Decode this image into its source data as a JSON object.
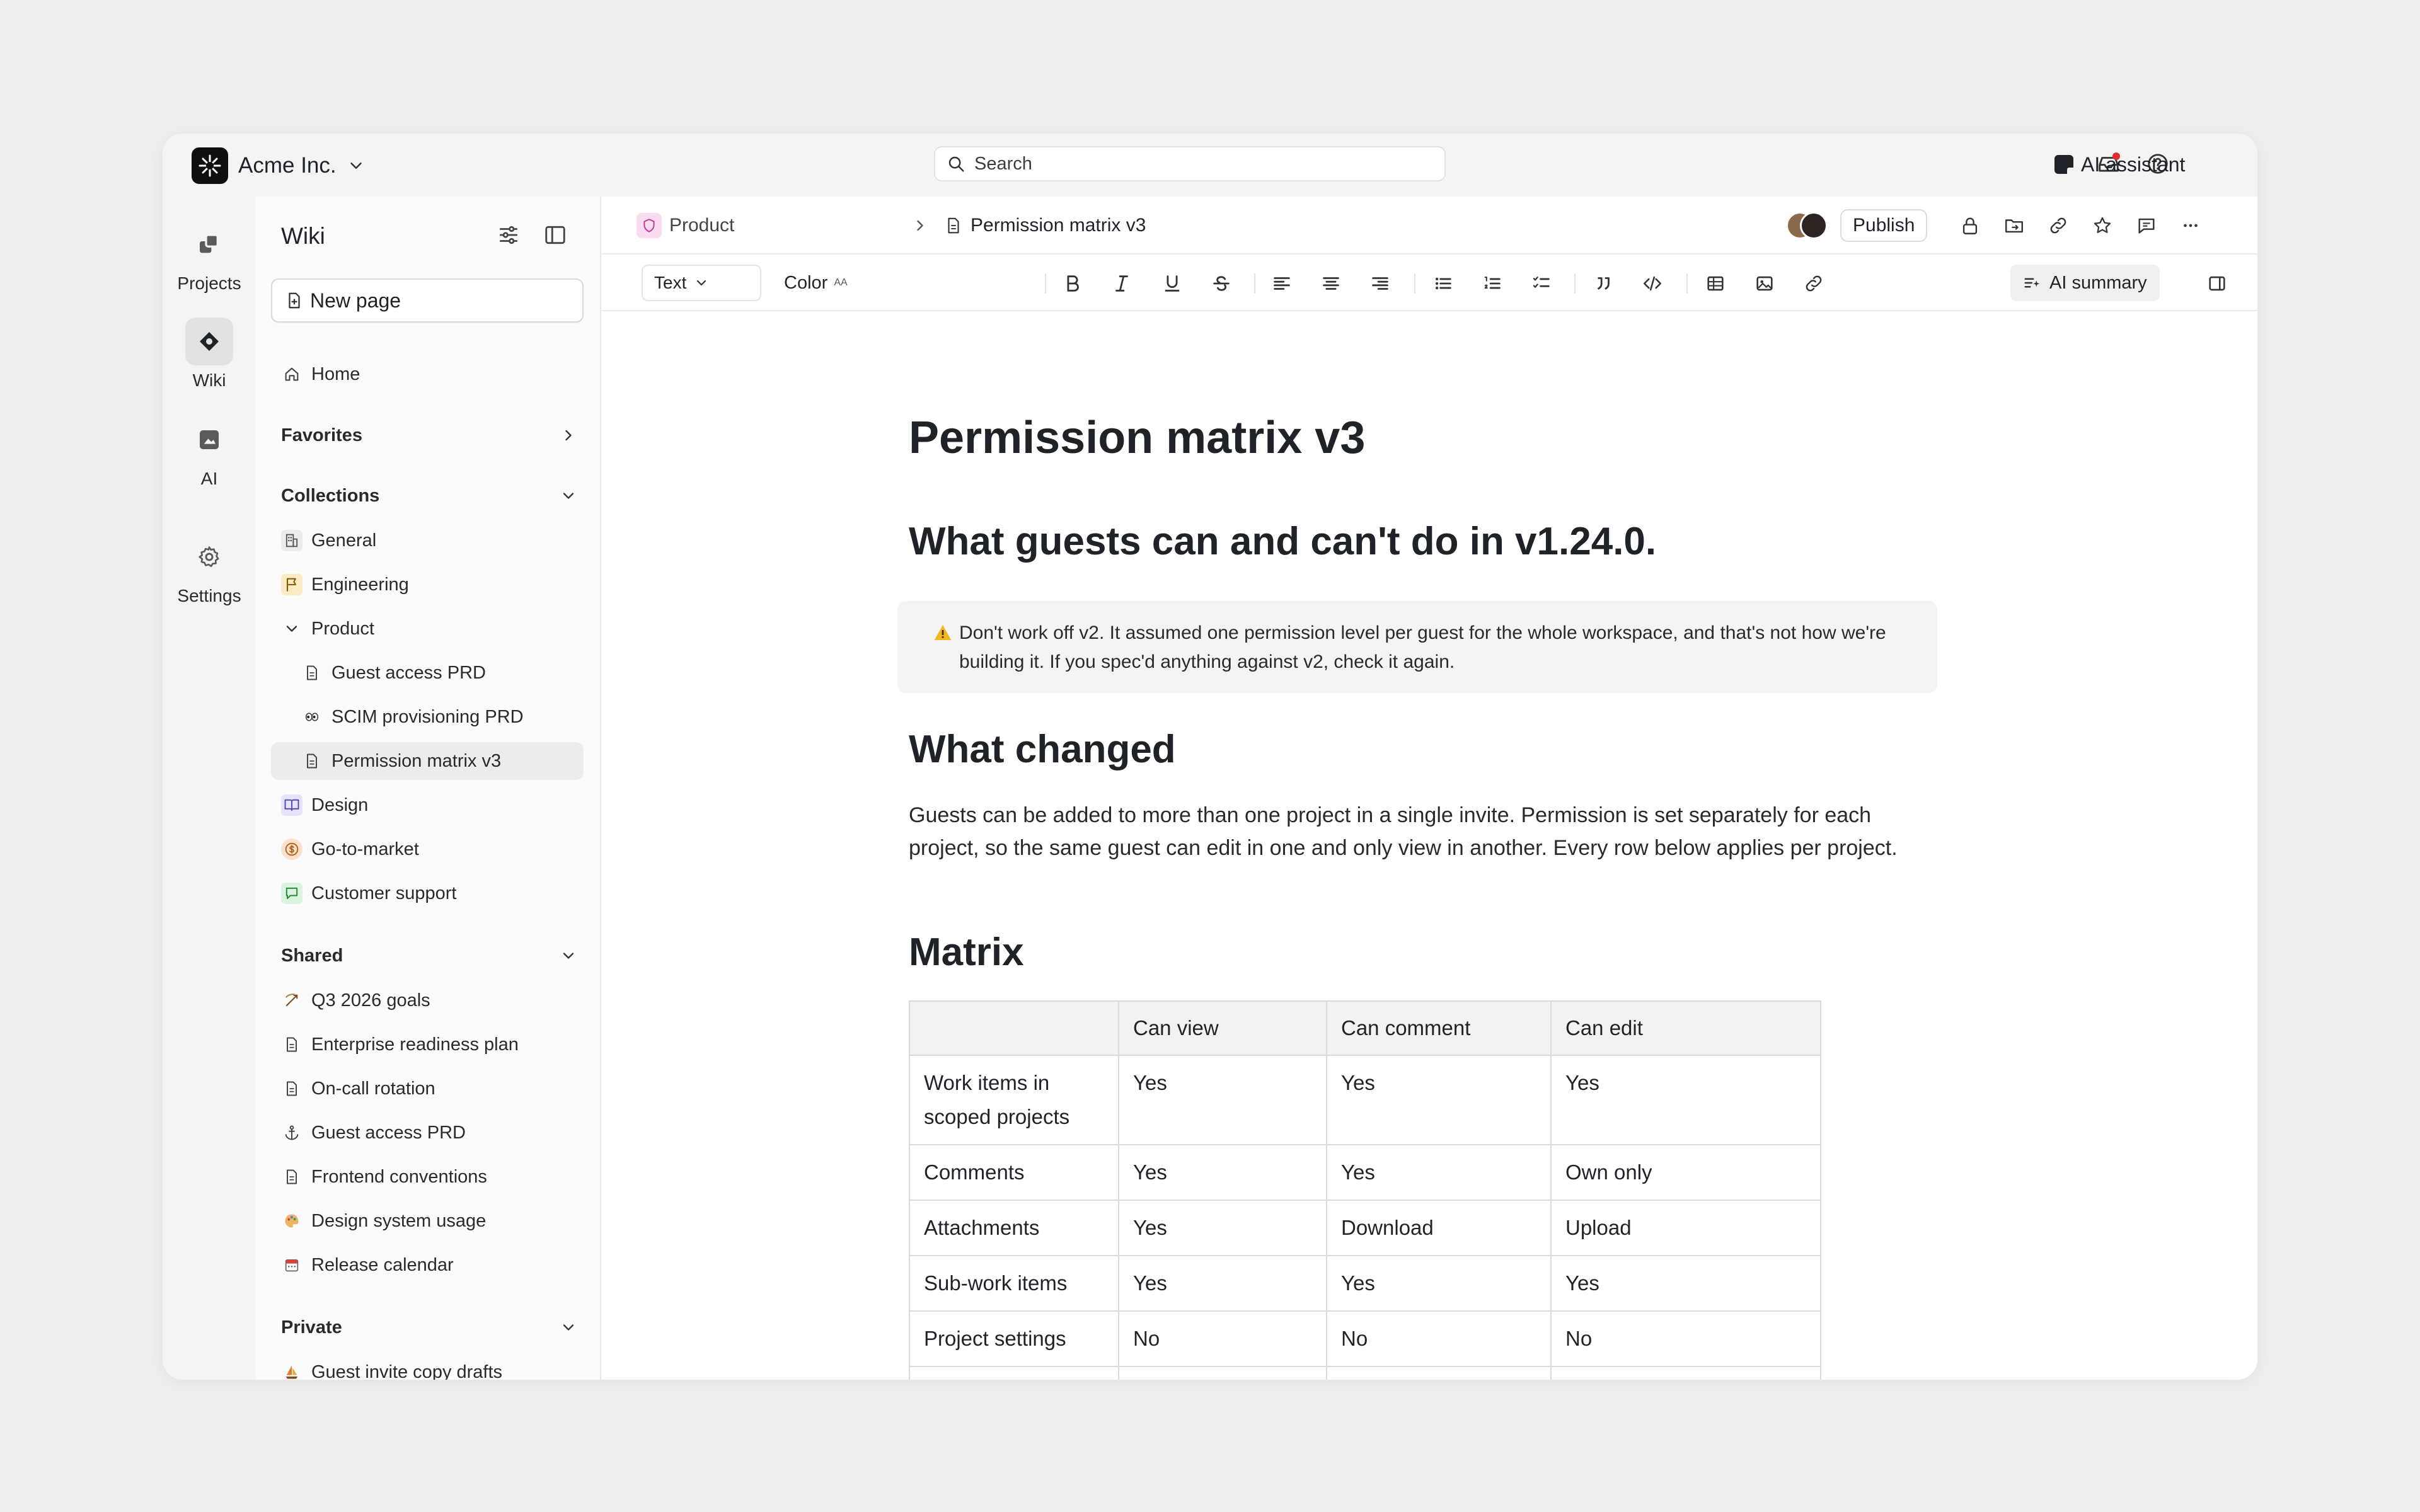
{
  "workspace": {
    "name": "Acme Inc."
  },
  "search": {
    "placeholder": "Search"
  },
  "topbar": {
    "ai_assistant": "AI assistant"
  },
  "rail": [
    {
      "label": "Projects",
      "icon": "projects-icon"
    },
    {
      "label": "Wiki",
      "icon": "wiki-icon"
    },
    {
      "label": "AI",
      "icon": "ai-icon"
    },
    {
      "label": "Settings",
      "icon": "gear-icon"
    }
  ],
  "sidebar": {
    "title": "Wiki",
    "new_page": "New page",
    "home": "Home",
    "favorites": "Favorites",
    "collections": {
      "label": "Collections",
      "items": [
        {
          "label": "General",
          "icon": "building-icon"
        },
        {
          "label": "Engineering",
          "icon": "flag-icon"
        },
        {
          "label": "Product",
          "icon": "chevron-down-icon"
        },
        {
          "label": "Guest access PRD",
          "icon": "document-icon"
        },
        {
          "label": "SCIM provisioning PRD",
          "icon": "eyes-emoji-icon"
        },
        {
          "label": "Permission matrix v3",
          "icon": "document-icon"
        },
        {
          "label": "Design",
          "icon": "book-icon"
        },
        {
          "label": "Go-to-market",
          "icon": "dollar-icon"
        },
        {
          "label": "Customer support",
          "icon": "chat-icon"
        }
      ]
    },
    "shared": {
      "label": "Shared",
      "items": [
        {
          "label": "Q3 2026 goals",
          "icon": "bow-arrow-icon"
        },
        {
          "label": "Enterprise readiness plan",
          "icon": "document-icon"
        },
        {
          "label": "On-call rotation",
          "icon": "document-icon"
        },
        {
          "label": "Guest access PRD",
          "icon": "anchor-icon"
        },
        {
          "label": "Frontend conventions",
          "icon": "document-icon"
        },
        {
          "label": "Design system usage",
          "icon": "palette-icon"
        },
        {
          "label": "Release calendar",
          "icon": "calendar-icon"
        }
      ]
    },
    "private": {
      "label": "Private",
      "items": [
        {
          "label": "Guest invite copy drafts",
          "icon": "sailboat-icon"
        }
      ]
    }
  },
  "breadcrumb": {
    "parent": "Product",
    "current": "Permission matrix v3"
  },
  "header": {
    "publish": "Publish"
  },
  "toolbar": {
    "text_style": "Text",
    "color": "Color",
    "color_hint": "AA",
    "ai_summary": "AI summary"
  },
  "doc": {
    "title": "Permission matrix v3",
    "h_guests": "What guests can and can't do in v1.24.0.",
    "callout": "Don't work off v2. It assumed one permission level per guest for the whole workspace, and that's not how we're building it. If you spec'd anything against v2, check it again.",
    "h_changed": "What changed",
    "changed_body": "Guests can be added to more than one project in a single invite. Permission is set separately for each project, so the same guest can edit in one and only view in another. Every row below applies per project.",
    "h_matrix": "Matrix",
    "matrix": {
      "headers": [
        "",
        "Can view",
        "Can comment",
        "Can edit"
      ],
      "rows": [
        [
          "Work items in scoped projects",
          "Yes",
          "Yes",
          "Yes"
        ],
        [
          "Comments",
          "Yes",
          "Yes",
          "Own only"
        ],
        [
          "Attachments",
          "Yes",
          "Download",
          "Upload"
        ],
        [
          "Sub-work items",
          "Yes",
          "Yes",
          "Yes"
        ],
        [
          "Project settings",
          "No",
          "No",
          "No"
        ]
      ]
    }
  },
  "colors": {
    "accent_red": "#e02f2f",
    "engineering_bg": "#fcebc4",
    "design_bg": "#e6e3fb",
    "gtm_bg": "#fbe1cc",
    "support_bg": "#dcf3df",
    "product_bg": "#f9dcef"
  }
}
